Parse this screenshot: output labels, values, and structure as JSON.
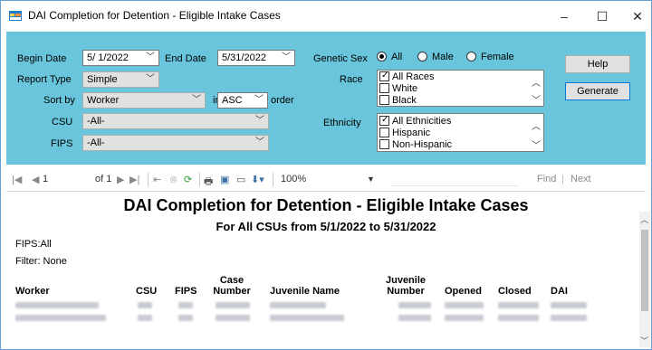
{
  "window": {
    "title": "DAI Completion for Detention - Eligible Intake Cases",
    "minimize": "–",
    "maximize": "☐",
    "close": "✕"
  },
  "params": {
    "begin_date_label": "Begin Date",
    "begin_date_value": "5/ 1/2022",
    "end_date_label": "End Date",
    "end_date_value": "5/31/2022",
    "report_type_label": "Report Type",
    "report_type_value": "Simple",
    "sort_by_label": "Sort by",
    "sort_by_value": "Worker",
    "in_label": "in",
    "order_value": "ASC",
    "order_label": "order",
    "csu_label": "CSU",
    "csu_value": "-All-",
    "fips_label": "FIPS",
    "fips_value": "-All-",
    "genetic_sex_label": "Genetic Sex",
    "sex_options": [
      {
        "label": "All",
        "selected": true
      },
      {
        "label": "Male",
        "selected": false
      },
      {
        "label": "Female",
        "selected": false
      }
    ],
    "race_label": "Race",
    "race_items": [
      {
        "label": "All Races",
        "checked": true
      },
      {
        "label": "White",
        "checked": false
      },
      {
        "label": "Black",
        "checked": false
      }
    ],
    "ethnicity_label": "Ethnicity",
    "ethnicity_items": [
      {
        "label": "All Ethnicities",
        "checked": true
      },
      {
        "label": "Hispanic",
        "checked": false
      },
      {
        "label": "Non-Hispanic",
        "checked": false
      }
    ],
    "help_button": "Help",
    "generate_button": "Generate"
  },
  "toolbar": {
    "page_current": "1",
    "page_of": "of 1",
    "zoom": "100%",
    "find": "Find",
    "find_sep": "|",
    "next": "Next"
  },
  "report": {
    "title": "DAI Completion for Detention - Eligible Intake Cases",
    "subtitle": "For All CSUs from 5/1/2022 to 5/31/2022",
    "fips_line": "FIPS:All",
    "filter_line": "Filter: None",
    "columns": [
      "Worker",
      "CSU",
      "FIPS",
      "Case Number",
      "Juvenile Name",
      "Juvenile Number",
      "Opened",
      "Closed",
      "DAI"
    ]
  },
  "colors": {
    "panel_bg": "#68c5db",
    "window_border": "#6a9fd4",
    "default_button_border": "#0078d7"
  }
}
